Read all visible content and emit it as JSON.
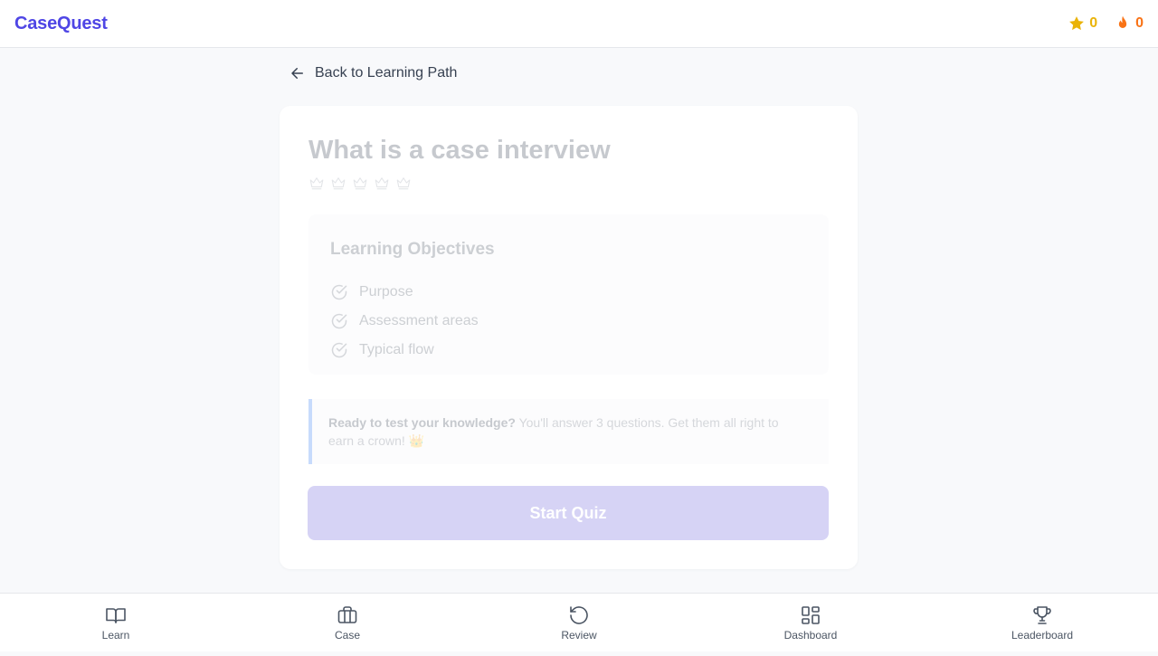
{
  "header": {
    "logo": "CaseQuest",
    "stars_count": "0",
    "streak_count": "0"
  },
  "back_link": "Back to Learning Path",
  "lesson": {
    "title": "What is a case interview",
    "crowns_earned": 0,
    "crowns_total": 5
  },
  "objectives": {
    "heading": "Learning Objectives",
    "items": [
      "Purpose",
      "Assessment areas",
      "Typical flow"
    ]
  },
  "callout": {
    "lead": "Ready to test your knowledge?",
    "text_line1": " You'll answer 3 questions. Get them all right to",
    "text_line2": "earn a crown! 👑"
  },
  "start_button": "Start Quiz",
  "nav": {
    "items": [
      {
        "label": "Learn",
        "icon": "book-icon"
      },
      {
        "label": "Case",
        "icon": "briefcase-icon"
      },
      {
        "label": "Review",
        "icon": "refresh-icon"
      },
      {
        "label": "Dashboard",
        "icon": "grid-icon"
      },
      {
        "label": "Leaderboard",
        "icon": "trophy-icon"
      }
    ]
  },
  "colors": {
    "brand": "#4f46e5",
    "star": "#eab308",
    "streak": "#f97316",
    "callout_border": "#3b82f6"
  }
}
